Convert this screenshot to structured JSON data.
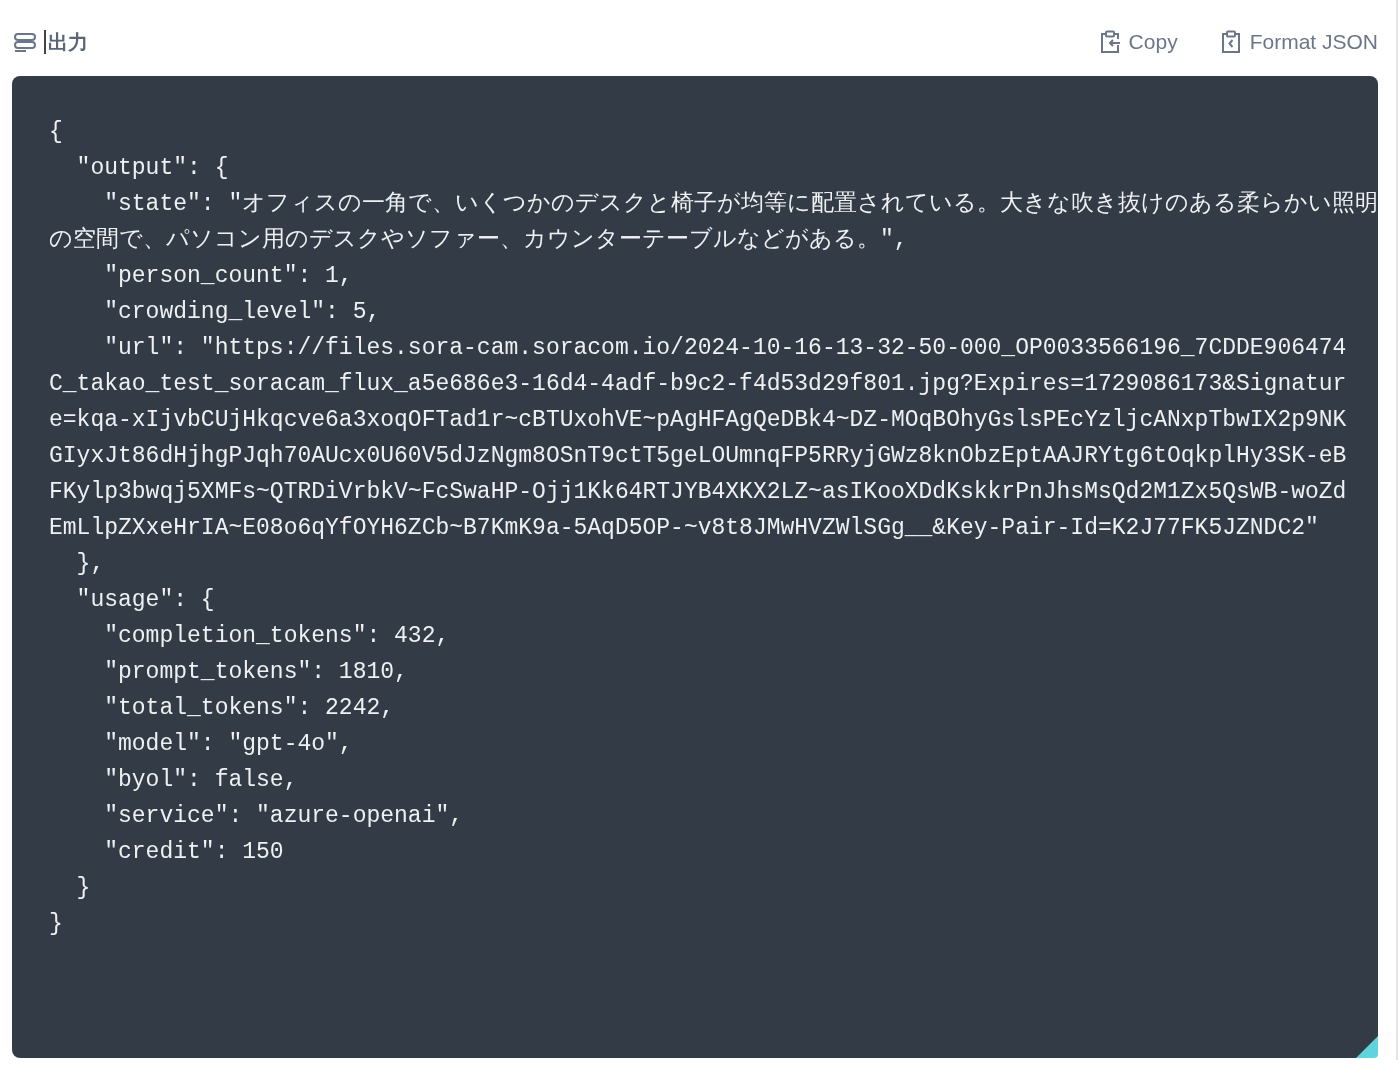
{
  "header": {
    "title": "出力",
    "buttons": [
      {
        "kind": "copy",
        "label": "Copy"
      },
      {
        "kind": "format",
        "label": "Format JSON"
      }
    ]
  },
  "editor": {
    "lines": [
      "{",
      "  \"output\": {",
      "    \"state\": \"オフィスの一角で、いくつかのデスクと椅子が均等に配置されている。大きな吹き抜けのある柔らかい照明",
      "の空間で、パソコン用のデスクやソファー、カウンターテーブルなどがある。\",",
      "    \"person_count\": 1,",
      "    \"crowding_level\": 5,",
      "    \"url\": \"https://files.sora-cam.soracom.io/2024-10-16-13-32-50-000_OP0033566196_7CDDE906474",
      "C_takao_test_soracam_flux_a5e686e3-16d4-4adf-b9c2-f4d53d29f801.jpg?Expires=1729086173&Signatur",
      "e=kqa-xIjvbCUjHkqcve6a3xoqOFTad1r~cBTUxohVE~pAgHFAgQeDBk4~DZ-MOqBOhyGslsPEcYzljcANxpTbwIX2p9NK",
      "GIyxJt86dHjhgPJqh70AUcx0U60V5dJzNgm8OSnT9ctT5geLOUmnqFP5RRyjGWz8knObzEptAAJRYtg6tOqkplHy3SK-eB",
      "FKylp3bwqj5XMFs~QTRDiVrbkV~FcSwaHP-Ojj1Kk64RTJYB4XKX2LZ~asIKooXDdKskkrPnJhsMsQd2M1Zx5QsWB-woZd",
      "EmLlpZXxeHrIA~E08o6qYfOYH6ZCb~B7KmK9a-5AqD5OP-~v8t8JMwHVZWlSGg__&Key-Pair-Id=K2J77FK5JZNDC2\"",
      "  },",
      "  \"usage\": {",
      "    \"completion_tokens\": 432,",
      "    \"prompt_tokens\": 1810,",
      "    \"total_tokens\": 2242,",
      "    \"model\": \"gpt-4o\",",
      "    \"byol\": false,",
      "    \"service\": \"azure-openai\",",
      "    \"credit\": 150",
      "  }",
      "}"
    ]
  }
}
